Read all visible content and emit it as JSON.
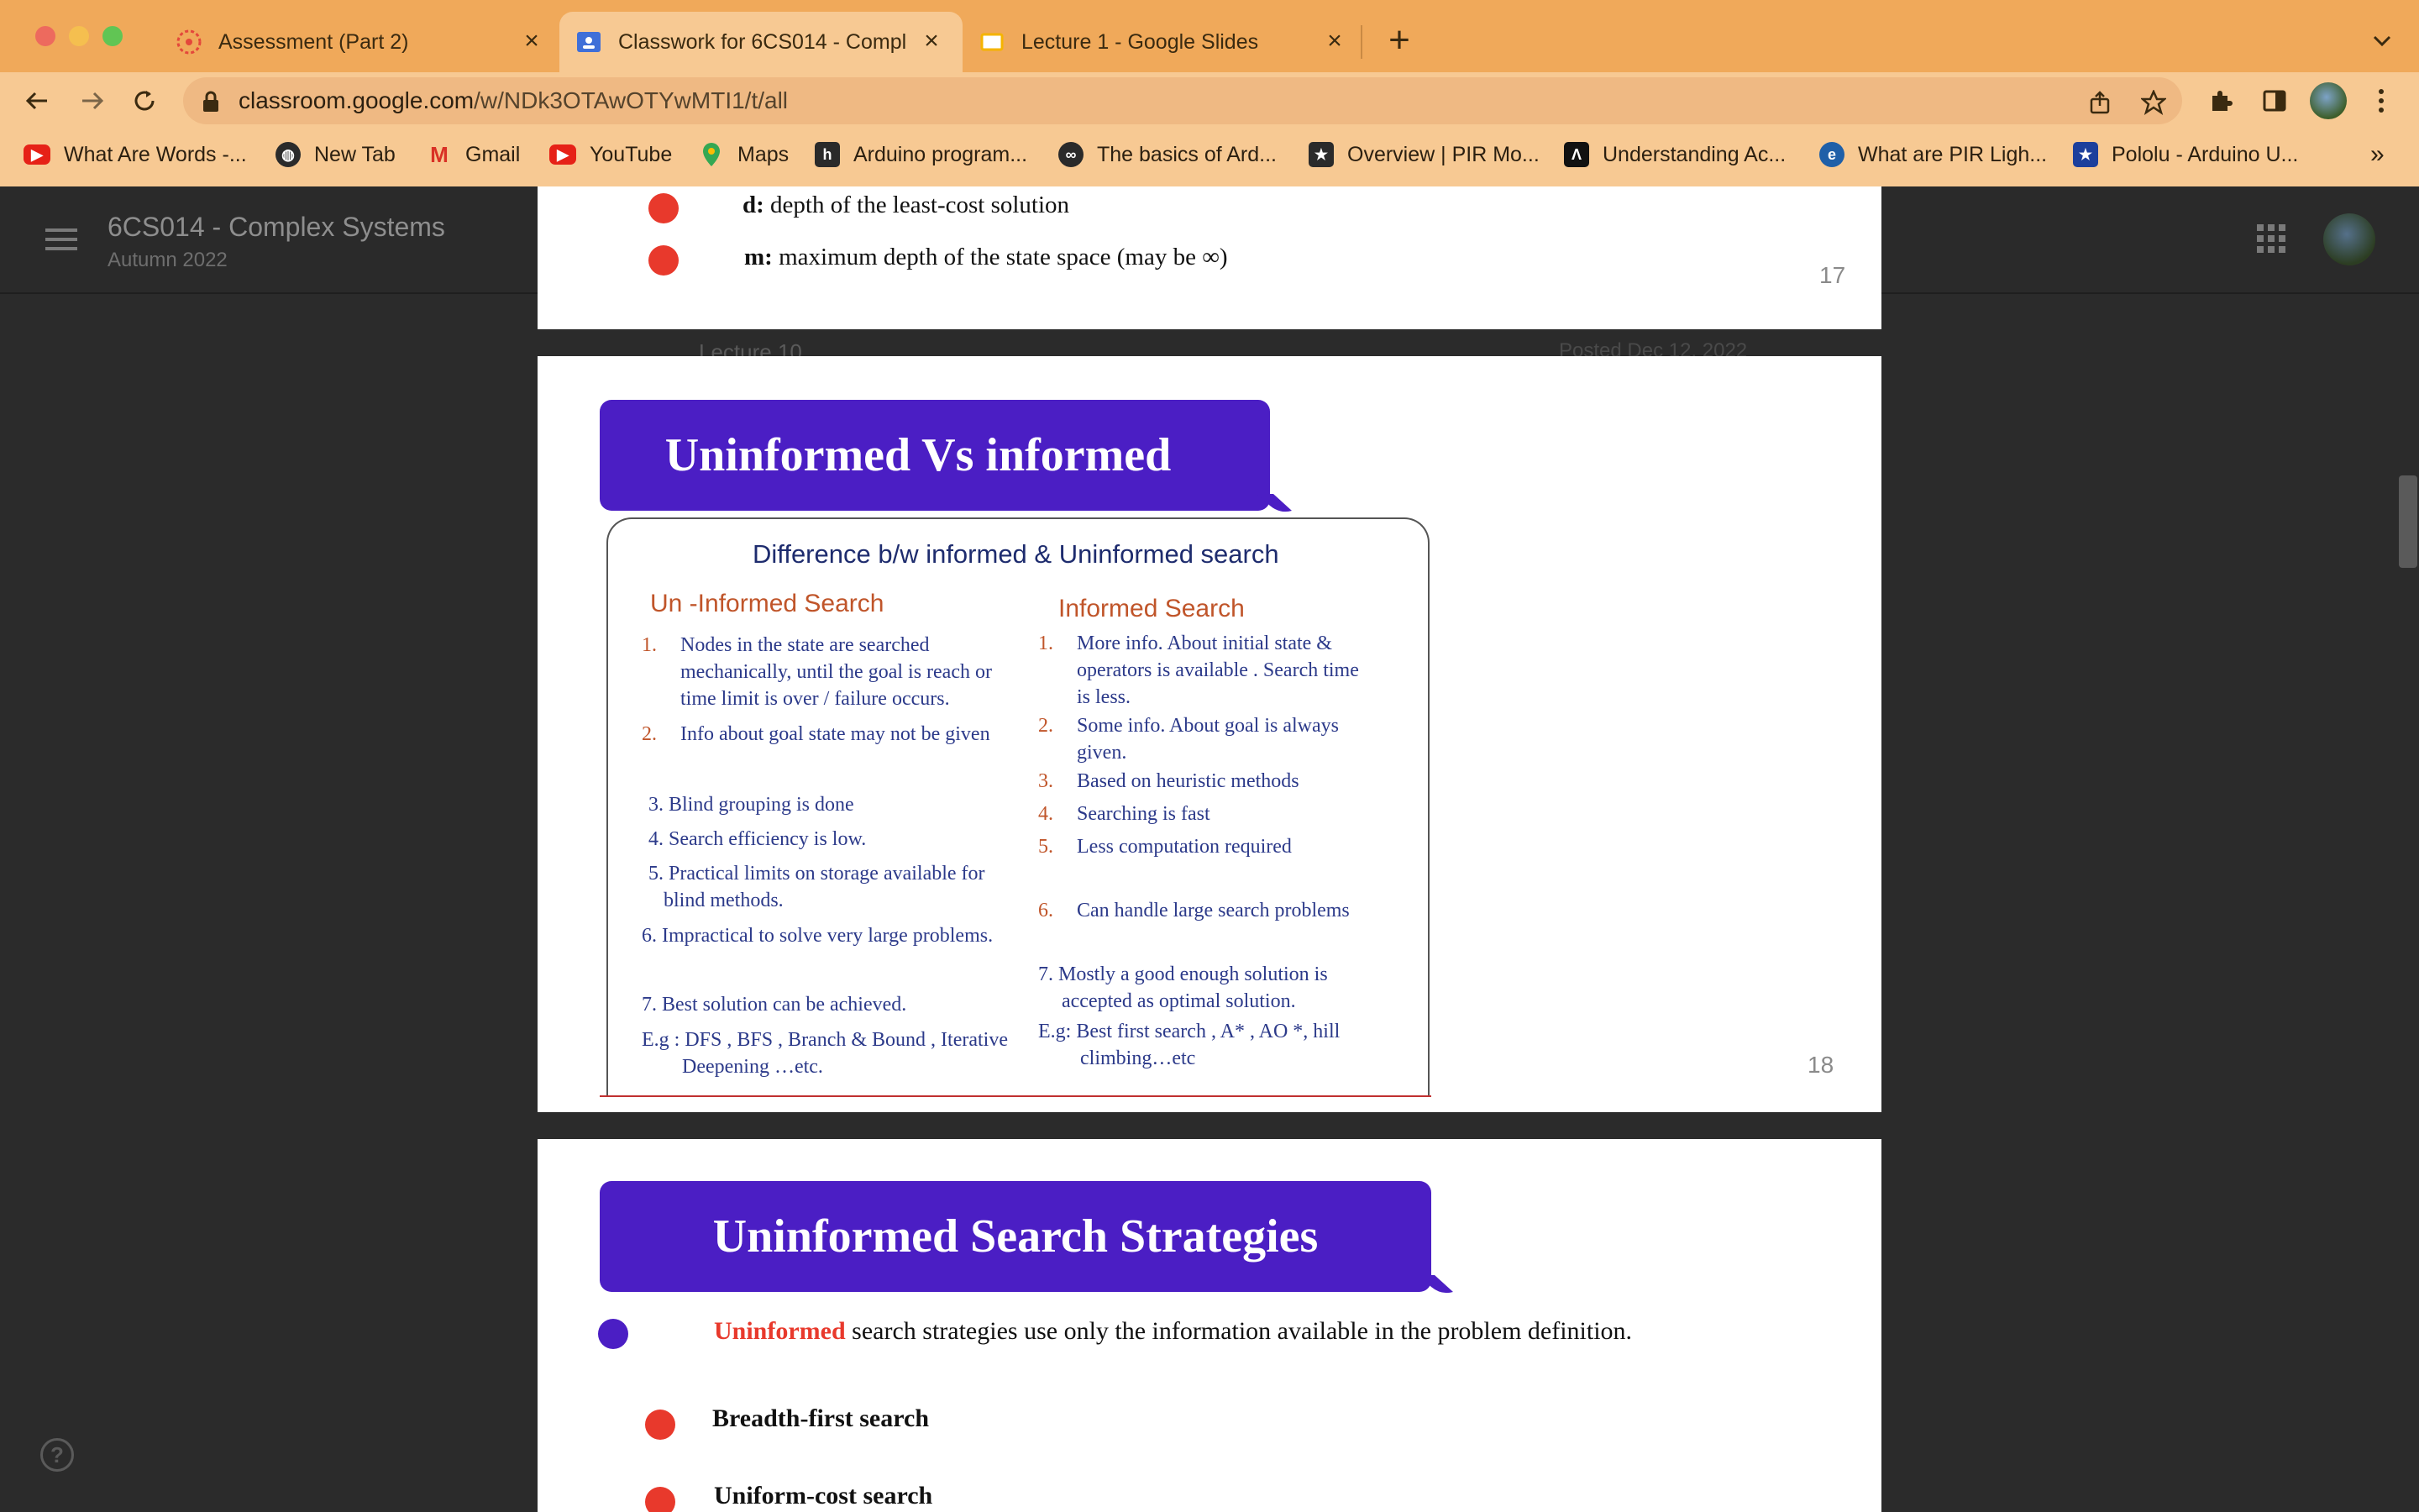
{
  "browser": {
    "tabs": [
      {
        "title": "Assessment (Part 2)"
      },
      {
        "title": "Classwork for 6CS014 - Compl"
      },
      {
        "title": "Lecture 1 - Google Slides"
      }
    ],
    "url_host": "classroom.google.com",
    "url_path": "/w/NDk3OTAwOTYwMTI1/t/all",
    "bookmarks": [
      {
        "label": "What Are Words -...",
        "icon": "youtube-icon"
      },
      {
        "label": "New Tab",
        "icon": "globe-icon"
      },
      {
        "label": "Gmail",
        "icon": "gmail-icon"
      },
      {
        "label": "YouTube",
        "icon": "youtube-icon"
      },
      {
        "label": "Maps",
        "icon": "maps-icon"
      },
      {
        "label": "Arduino program...",
        "icon": "h-icon"
      },
      {
        "label": "The basics of Ard...",
        "icon": "infinity-icon"
      },
      {
        "label": "Overview | PIR Mo...",
        "icon": "star-icon"
      },
      {
        "label": "Understanding Ac...",
        "icon": "a-icon"
      },
      {
        "label": "What are PIR Ligh...",
        "icon": "e-icon"
      },
      {
        "label": "Pololu - Arduino U...",
        "icon": "pololu-icon"
      }
    ],
    "more_bookmarks": "»"
  },
  "classroom": {
    "course_title": "6CS014 - Complex Systems",
    "term": "Autumn 2022",
    "underlying_item": "Lecture 10",
    "underlying_posted": "Posted Dec 12, 2022",
    "help": "?"
  },
  "slide17": {
    "bullets": [
      {
        "key": "d:",
        "text": " depth of the least-cost solution"
      },
      {
        "key": "m:",
        "text": " maximum depth of the state space (may be ∞)"
      }
    ],
    "page": "17"
  },
  "slide18": {
    "title": "Uninformed Vs informed",
    "box_title": "Difference b/w informed & Uninformed search",
    "left_header": "Un -Informed Search",
    "right_header": "Informed Search",
    "left_items": [
      {
        "num": "1.",
        "lines": [
          "Nodes in the state are searched",
          "mechanically, until the goal is reach or",
          "time limit is over / failure occurs."
        ]
      },
      {
        "num": "2.",
        "lines": [
          "Info about goal state may not be given"
        ]
      },
      {
        "num": "",
        "lines": [
          "3. Blind grouping is done"
        ]
      },
      {
        "num": "",
        "lines": [
          "4. Search efficiency is low."
        ]
      },
      {
        "num": "",
        "lines": [
          "5. Practical limits on storage available for",
          "blind methods."
        ]
      },
      {
        "num": "",
        "lines": [
          "6. Impractical to solve very large problems."
        ]
      },
      {
        "num": "",
        "lines": [
          "7. Best solution can be achieved."
        ]
      },
      {
        "num": "",
        "lines": [
          "E.g : DFS , BFS , Branch & Bound , Iterative",
          "Deepening …etc."
        ]
      }
    ],
    "right_items": [
      {
        "num": "1.",
        "lines": [
          "More info. About initial state &",
          "operators is available . Search time",
          "is  less."
        ]
      },
      {
        "num": "2.",
        "lines": [
          "Some info. About goal is always",
          "given."
        ]
      },
      {
        "num": "3.",
        "lines": [
          "Based on heuristic methods"
        ]
      },
      {
        "num": "4.",
        "lines": [
          "Searching is fast"
        ]
      },
      {
        "num": "5.",
        "lines": [
          "Less computation required"
        ]
      },
      {
        "num": "6.",
        "lines": [
          "Can handle large search problems"
        ]
      },
      {
        "num": "",
        "lines": [
          "7. Mostly a good enough solution is",
          "accepted as optimal solution."
        ]
      },
      {
        "num": "",
        "lines": [
          "E.g: Best first search , A* , AO *, hill",
          "climbing…etc"
        ]
      }
    ],
    "page": "18"
  },
  "slide19": {
    "title": "Uninformed Search Strategies",
    "intro_highlight": "Uninformed",
    "intro_rest": " search strategies use only the information available in the problem definition.",
    "bullets": [
      "Breadth-first search",
      "Uniform-cost search"
    ]
  }
}
